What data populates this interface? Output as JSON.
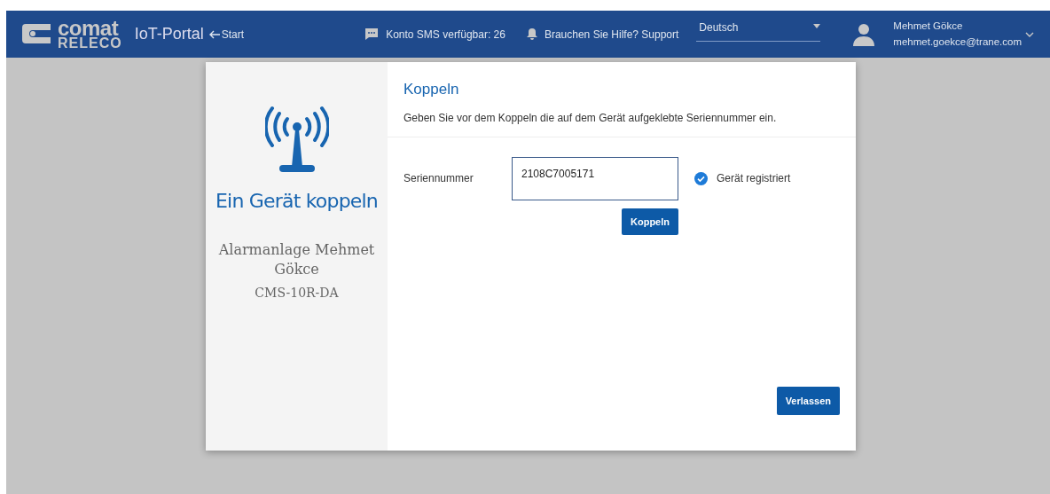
{
  "navbar": {
    "logo_top": "comat",
    "logo_bottom": "RELECO",
    "app_title": "IoT-Portal",
    "back_link": "Start",
    "sms": "Konto SMS verfügbar: 26",
    "help": "Brauchen Sie Hilfe? Support",
    "language": "Deutsch",
    "user_name": "Mehmet Gökce",
    "user_email": "mehmet.goekce@trane.com"
  },
  "dialog": {
    "side_title": "Ein Gerät koppeln",
    "device_name": "Alarmanlage Mehmet Gökce",
    "device_model": "CMS-10R-DA",
    "title": "Koppeln",
    "subtitle": "Geben Sie vor dem Koppeln die auf dem Gerät aufgeklebte Seriennummer ein.",
    "field_label": "Seriennummer",
    "serial": "2108C7005171",
    "registered": true,
    "status": "Gerät registriert",
    "pair_button": "Koppeln",
    "leave_button": "Verlassen"
  }
}
